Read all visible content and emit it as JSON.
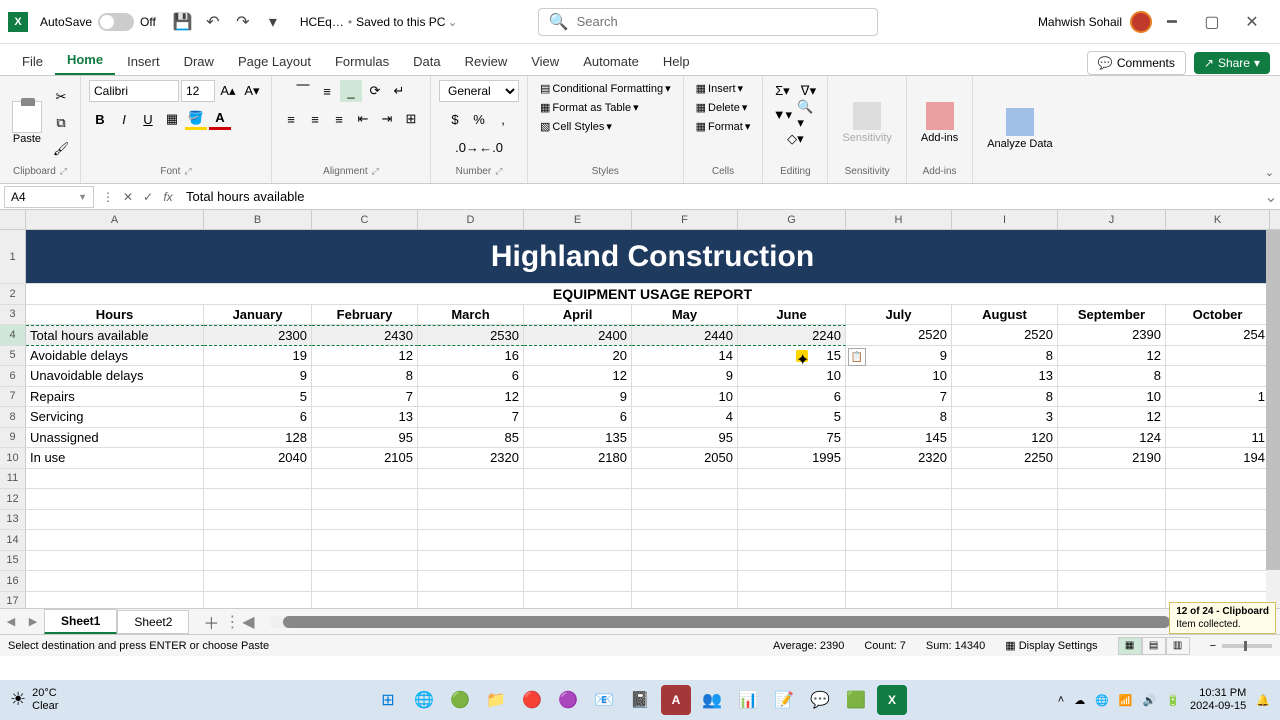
{
  "titlebar": {
    "autosave_label": "AutoSave",
    "autosave_state": "Off",
    "filename": "HCEq…",
    "saved_status": "Saved to this PC",
    "search_placeholder": "Search",
    "username": "Mahwish Sohail"
  },
  "menutabs": {
    "file": "File",
    "home": "Home",
    "insert": "Insert",
    "draw": "Draw",
    "page_layout": "Page Layout",
    "formulas": "Formulas",
    "data": "Data",
    "review": "Review",
    "view": "View",
    "automate": "Automate",
    "help": "Help",
    "comments": "Comments",
    "share": "Share"
  },
  "ribbon": {
    "paste": "Paste",
    "clipboard_label": "Clipboard",
    "font_name": "Calibri",
    "font_size": "12",
    "font_label": "Font",
    "alignment_label": "Alignment",
    "number_format": "General",
    "number_label": "Number",
    "cond_fmt": "Conditional Formatting",
    "fmt_table": "Format as Table",
    "cell_styles": "Cell Styles",
    "styles_label": "Styles",
    "insert": "Insert",
    "delete": "Delete",
    "format": "Format",
    "cells_label": "Cells",
    "editing_label": "Editing",
    "sensitivity": "Sensitivity",
    "sensitivity_label": "Sensitivity",
    "addins": "Add-ins",
    "addins_label": "Add-ins",
    "analyze": "Analyze Data"
  },
  "formulabar": {
    "namebox": "A4",
    "content": "Total hours available"
  },
  "columns": [
    "A",
    "B",
    "C",
    "D",
    "E",
    "F",
    "G",
    "H",
    "I",
    "J",
    "K"
  ],
  "sheet": {
    "row1_title": "Highland Construction",
    "row2_title": "EQUIPMENT USAGE REPORT",
    "headers": [
      "Hours",
      "January",
      "February",
      "March",
      "April",
      "May",
      "June",
      "July",
      "August",
      "September",
      "October"
    ],
    "data_rows": [
      {
        "label": "Total hours available",
        "values": [
          "2300",
          "2430",
          "2530",
          "2400",
          "2440",
          "2240",
          "2520",
          "2520",
          "2390",
          "254"
        ]
      },
      {
        "label": "Avoidable delays",
        "values": [
          "19",
          "12",
          "16",
          "20",
          "14",
          "15",
          "9",
          "8",
          "12",
          ""
        ]
      },
      {
        "label": "Unavoidable delays",
        "values": [
          "9",
          "8",
          "6",
          "12",
          "9",
          "10",
          "10",
          "13",
          "8",
          ""
        ]
      },
      {
        "label": "Repairs",
        "values": [
          "5",
          "7",
          "12",
          "9",
          "10",
          "6",
          "7",
          "8",
          "10",
          "1"
        ]
      },
      {
        "label": "Servicing",
        "values": [
          "6",
          "13",
          "7",
          "6",
          "4",
          "5",
          "8",
          "3",
          "12",
          ""
        ]
      },
      {
        "label": "Unassigned",
        "values": [
          "128",
          "95",
          "85",
          "135",
          "95",
          "75",
          "145",
          "120",
          "124",
          "11"
        ]
      },
      {
        "label": "In use",
        "values": [
          "2040",
          "2105",
          "2320",
          "2180",
          "2050",
          "1995",
          "2320",
          "2250",
          "2190",
          "194"
        ]
      }
    ],
    "first_data_rownum": 4
  },
  "sheettabs": {
    "active": "Sheet1",
    "other": "Sheet2"
  },
  "status": {
    "mode": "Select destination and press ENTER or choose Paste",
    "average": "Average: 2390",
    "count": "Count: 7",
    "sum": "Sum: 14340",
    "display": "Display Settings",
    "zoom": "100%"
  },
  "clipboard_toast": {
    "line1": "12 of 24 - Clipboard",
    "line2": "Item collected."
  },
  "taskbar": {
    "temp": "20°C",
    "weather": "Clear",
    "time": "10:31 PM",
    "date": "2024-09-15"
  },
  "chart_data": {
    "type": "table",
    "title": "Highland Construction — EQUIPMENT USAGE REPORT",
    "columns": [
      "Hours",
      "January",
      "February",
      "March",
      "April",
      "May",
      "June",
      "July",
      "August",
      "September"
    ],
    "rows": [
      [
        "Total hours available",
        2300,
        2430,
        2530,
        2400,
        2440,
        2240,
        2520,
        2520,
        2390
      ],
      [
        "Avoidable delays",
        19,
        12,
        16,
        20,
        14,
        15,
        9,
        8,
        12
      ],
      [
        "Unavoidable delays",
        9,
        8,
        6,
        12,
        9,
        10,
        10,
        13,
        8
      ],
      [
        "Repairs",
        5,
        7,
        12,
        9,
        10,
        6,
        7,
        8,
        10
      ],
      [
        "Servicing",
        6,
        13,
        7,
        6,
        4,
        5,
        8,
        3,
        12
      ],
      [
        "Unassigned",
        128,
        95,
        85,
        135,
        95,
        75,
        145,
        120,
        124
      ],
      [
        "In use",
        2040,
        2105,
        2320,
        2180,
        2050,
        1995,
        2320,
        2250,
        2190
      ]
    ]
  }
}
